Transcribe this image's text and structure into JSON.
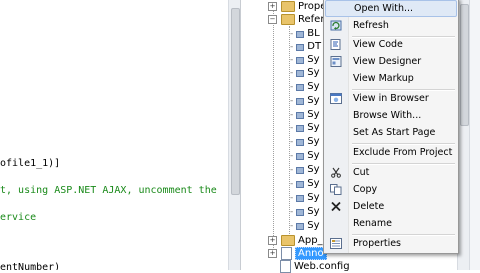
{
  "editor": {
    "lines": [
      {
        "text": "ofile1_1)]",
        "kind": "code"
      },
      {
        "text_prefix": "t, using ",
        "text_kw": "ASP.NET AJAX",
        "text_suffix": ", uncomment the",
        "kind": "mixed"
      },
      {
        "text": "ervice",
        "kind": "comment"
      },
      {
        "text": "entNumber)",
        "kind": "code"
      }
    ]
  },
  "explorer": {
    "items": [
      {
        "label": "Prope",
        "kind": "folder",
        "expander": "+"
      },
      {
        "label": "Refere",
        "kind": "folder",
        "expander": "−"
      },
      {
        "label": "BL",
        "kind": "ref"
      },
      {
        "label": "DT",
        "kind": "ref"
      },
      {
        "label": "Sy",
        "kind": "ref"
      },
      {
        "label": "Sy",
        "kind": "ref"
      },
      {
        "label": "Sy",
        "kind": "ref"
      },
      {
        "label": "Sy",
        "kind": "ref"
      },
      {
        "label": "Sy",
        "kind": "ref"
      },
      {
        "label": "Sy",
        "kind": "ref"
      },
      {
        "label": "Sy",
        "kind": "ref"
      },
      {
        "label": "Sy",
        "kind": "ref"
      },
      {
        "label": "Sy",
        "kind": "ref"
      },
      {
        "label": "Sy",
        "kind": "ref"
      },
      {
        "label": "Sy",
        "kind": "ref"
      },
      {
        "label": "Sy",
        "kind": "ref"
      },
      {
        "label": "Sy",
        "kind": "ref"
      },
      {
        "label": "Sy",
        "kind": "ref"
      },
      {
        "label": "App_C",
        "kind": "folder",
        "expander": "+"
      },
      {
        "label": "Anno",
        "kind": "file-selected",
        "expander": "+"
      },
      {
        "label": "Web.config",
        "kind": "file"
      }
    ]
  },
  "context_menu": {
    "items": [
      {
        "label": "Open With...",
        "icon": "none",
        "hover": true
      },
      {
        "label": "Refresh",
        "icon": "refresh-icon"
      },
      {
        "sep": true
      },
      {
        "label": "View Code",
        "icon": "view-code-icon"
      },
      {
        "label": "View Designer",
        "icon": "view-designer-icon"
      },
      {
        "label": "View Markup",
        "icon": "none"
      },
      {
        "sep": true
      },
      {
        "label": "View in Browser",
        "icon": "browser-icon"
      },
      {
        "label": "Browse With...",
        "icon": "none"
      },
      {
        "label": "Set As Start Page",
        "icon": "none"
      },
      {
        "sep": true
      },
      {
        "label": "Exclude From Project",
        "icon": "none"
      },
      {
        "sep": true
      },
      {
        "label": "Cut",
        "icon": "cut-icon"
      },
      {
        "label": "Copy",
        "icon": "copy-icon"
      },
      {
        "label": "Delete",
        "icon": "delete-icon"
      },
      {
        "label": "Rename",
        "icon": "none"
      },
      {
        "sep": true
      },
      {
        "label": "Properties",
        "icon": "properties-icon"
      }
    ]
  },
  "colors": {
    "selection": "#3399ff",
    "menu_hover": "#dfe9f6",
    "keyword": "#1a3fd0",
    "comment": "#1a8a1a"
  }
}
